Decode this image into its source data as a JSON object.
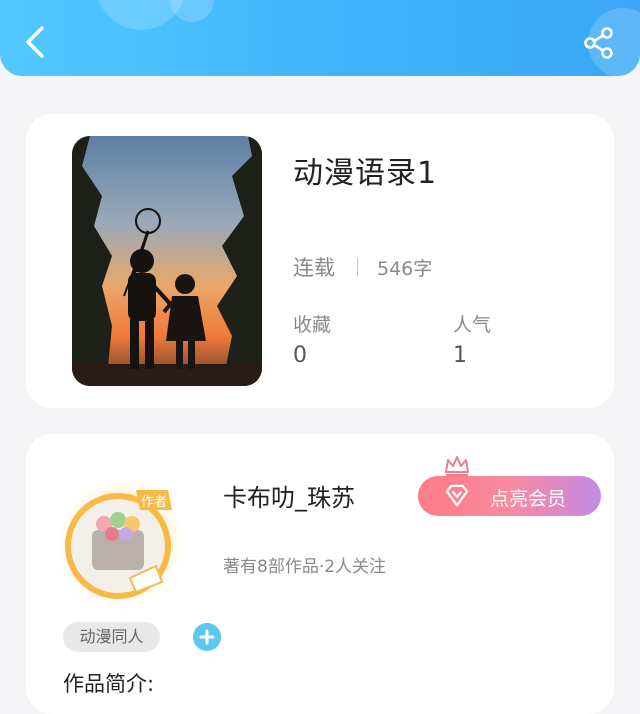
{
  "header": {
    "back_icon": "chevron-left-icon",
    "share_icon": "share-icon",
    "gradient": [
      "#52c9ff",
      "#3aa7f6"
    ]
  },
  "work": {
    "title": "动漫语录1",
    "status": "连载",
    "word_count": "546字",
    "stats": [
      {
        "label": "收藏",
        "value": "0"
      },
      {
        "label": "人气",
        "value": "1"
      }
    ]
  },
  "author": {
    "name": "卡布叻_珠苏",
    "avatar_badge": "作者",
    "vip_button": "点亮会员",
    "meta": "著有8部作品·2人关注",
    "tag": "动漫同人",
    "intro_label": "作品简介:"
  },
  "colors": {
    "accent_blue": "#3fb4fb",
    "vip_pink": "#ff7b88",
    "vip_purple": "#c28be6"
  }
}
